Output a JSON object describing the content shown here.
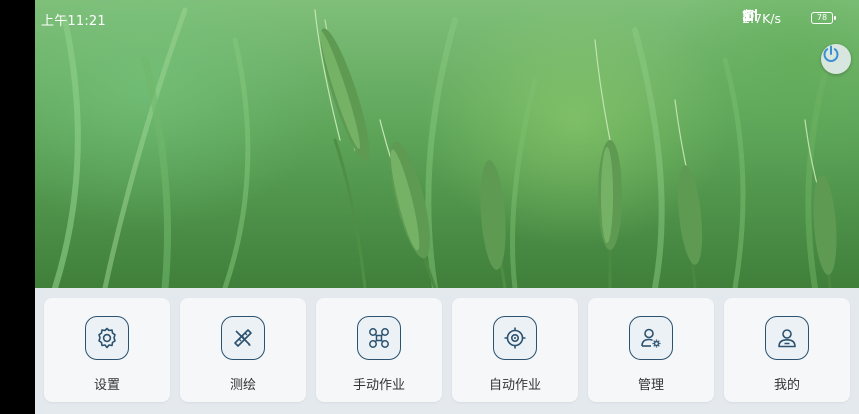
{
  "status_bar": {
    "time": "上午11:21",
    "net_speed": "2.7K/s",
    "battery": "78"
  },
  "menu": {
    "items": [
      {
        "label": "设置",
        "icon": "gear-icon"
      },
      {
        "label": "测绘",
        "icon": "ruler-pencil-icon"
      },
      {
        "label": "手动作业",
        "icon": "drone-icon"
      },
      {
        "label": "自动作业",
        "icon": "target-icon"
      },
      {
        "label": "管理",
        "icon": "user-gear-icon"
      },
      {
        "label": "我的",
        "icon": "user-icon"
      }
    ]
  },
  "colors": {
    "accent": "#2b5270",
    "card": "#f5f7f9",
    "panel": "#e4e9ee"
  }
}
